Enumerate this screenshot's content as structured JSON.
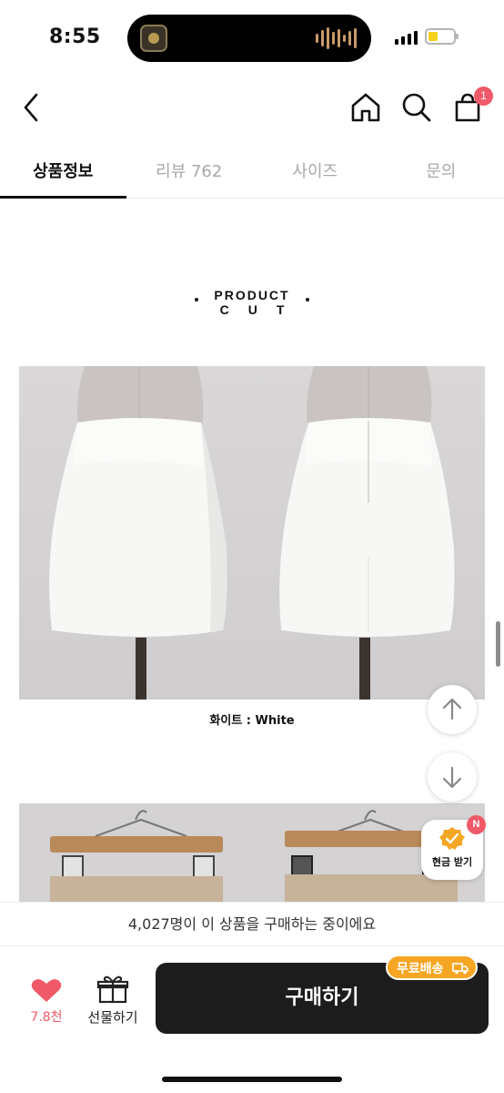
{
  "status_bar": {
    "time": "8:55"
  },
  "header": {
    "cart_count": "1"
  },
  "tabs": [
    {
      "label": "상품정보",
      "active": true
    },
    {
      "label": "리뷰 762",
      "active": false
    },
    {
      "label": "사이즈",
      "active": false
    },
    {
      "label": "문의",
      "active": false
    }
  ],
  "content": {
    "title_line1": "PRODUCT",
    "title_line2": "CUT",
    "caption": "화이트 : White"
  },
  "floating": {
    "cash_label": "현금 받기",
    "cash_badge": "N"
  },
  "bottom_bar": {
    "buying_text": "4,027명이 이 상품을 구매하는 중이에요",
    "like_count": "7.8천",
    "gift_label": "선물하기",
    "buy_label": "구매하기",
    "free_shipping": "무료배송"
  },
  "colors": {
    "accent": "#f05a68",
    "shipping": "#f6a623",
    "button": "#1c1c1c"
  }
}
